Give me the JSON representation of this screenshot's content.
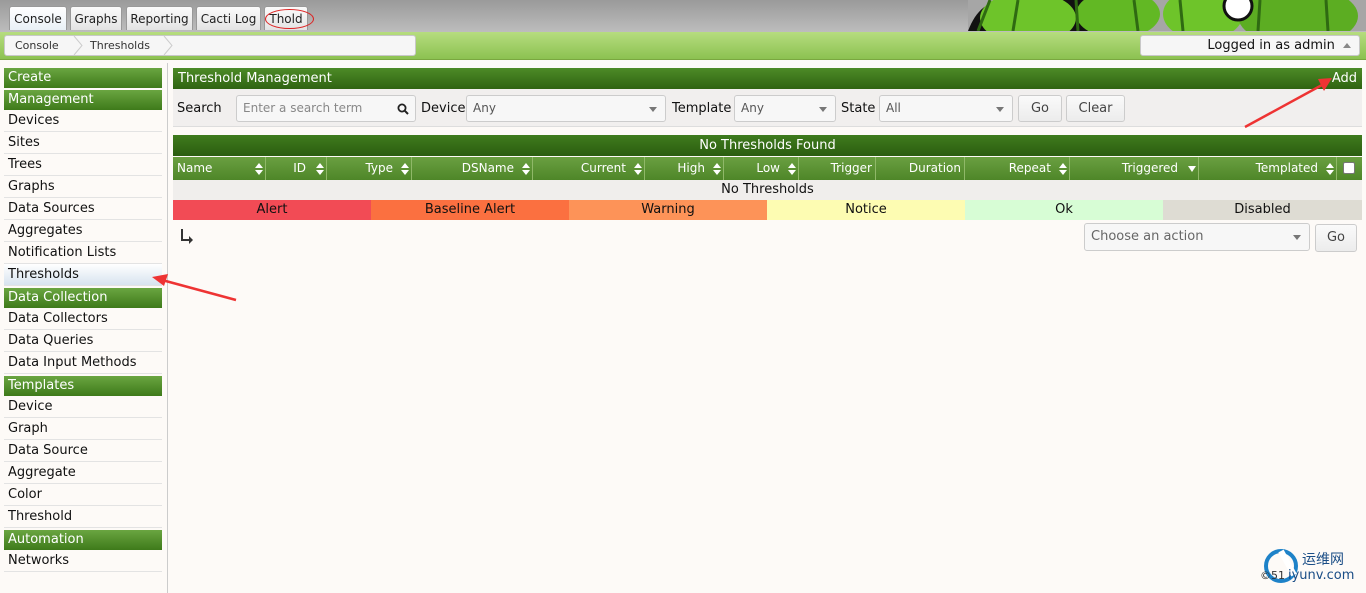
{
  "tabs": [
    {
      "label": "Console",
      "active": true
    },
    {
      "label": "Graphs"
    },
    {
      "label": "Reporting"
    },
    {
      "label": "Cacti Log"
    },
    {
      "label": "Thold"
    }
  ],
  "breadcrumb": [
    "Console",
    "Thresholds"
  ],
  "user_status": "Logged in as admin",
  "sidebar": {
    "groups": [
      {
        "label": "Create",
        "items": []
      },
      {
        "label": "Management",
        "items": [
          "Devices",
          "Sites",
          "Trees",
          "Graphs",
          "Data Sources",
          "Aggregates",
          "Notification Lists",
          "Thresholds"
        ]
      },
      {
        "label": "Data Collection",
        "items": [
          "Data Collectors",
          "Data Queries",
          "Data Input Methods"
        ]
      },
      {
        "label": "Templates",
        "items": [
          "Device",
          "Graph",
          "Data Source",
          "Aggregate",
          "Color",
          "Threshold"
        ]
      },
      {
        "label": "Automation",
        "items": [
          "Networks"
        ]
      }
    ],
    "selected": "Thresholds"
  },
  "main": {
    "title": "Threshold Management",
    "add_label": "Add",
    "filter": {
      "search_label": "Search",
      "search_placeholder": "Enter a search term",
      "device_label": "Device",
      "device_value": "Any",
      "template_label": "Template",
      "template_value": "Any",
      "state_label": "State",
      "state_value": "All",
      "go_label": "Go",
      "clear_label": "Clear"
    },
    "results_title": "No Thresholds Found",
    "columns": [
      "Name",
      "ID",
      "Type",
      "DSName",
      "Current",
      "High",
      "Low",
      "Trigger",
      "Duration",
      "Repeat",
      "Triggered",
      "Templated"
    ],
    "empty_message": "No Thresholds",
    "legend": [
      {
        "label": "Alert",
        "color": "#f24b55"
      },
      {
        "label": "Baseline Alert",
        "color": "#fb7040"
      },
      {
        "label": "Warning",
        "color": "#fd9358"
      },
      {
        "label": "Notice",
        "color": "#fdfcb2"
      },
      {
        "label": "Ok",
        "color": "#d7fdd5"
      },
      {
        "label": "Disabled",
        "color": "#dedcd3"
      }
    ],
    "action_placeholder": "Choose an action",
    "action_go": "Go"
  },
  "watermark": {
    "line1": "运维网",
    "line2": "iyunv.com",
    "prefix": "©51"
  },
  "colors": {
    "accent_green": "#4d8b27",
    "annotation_red": "#ee3333"
  }
}
